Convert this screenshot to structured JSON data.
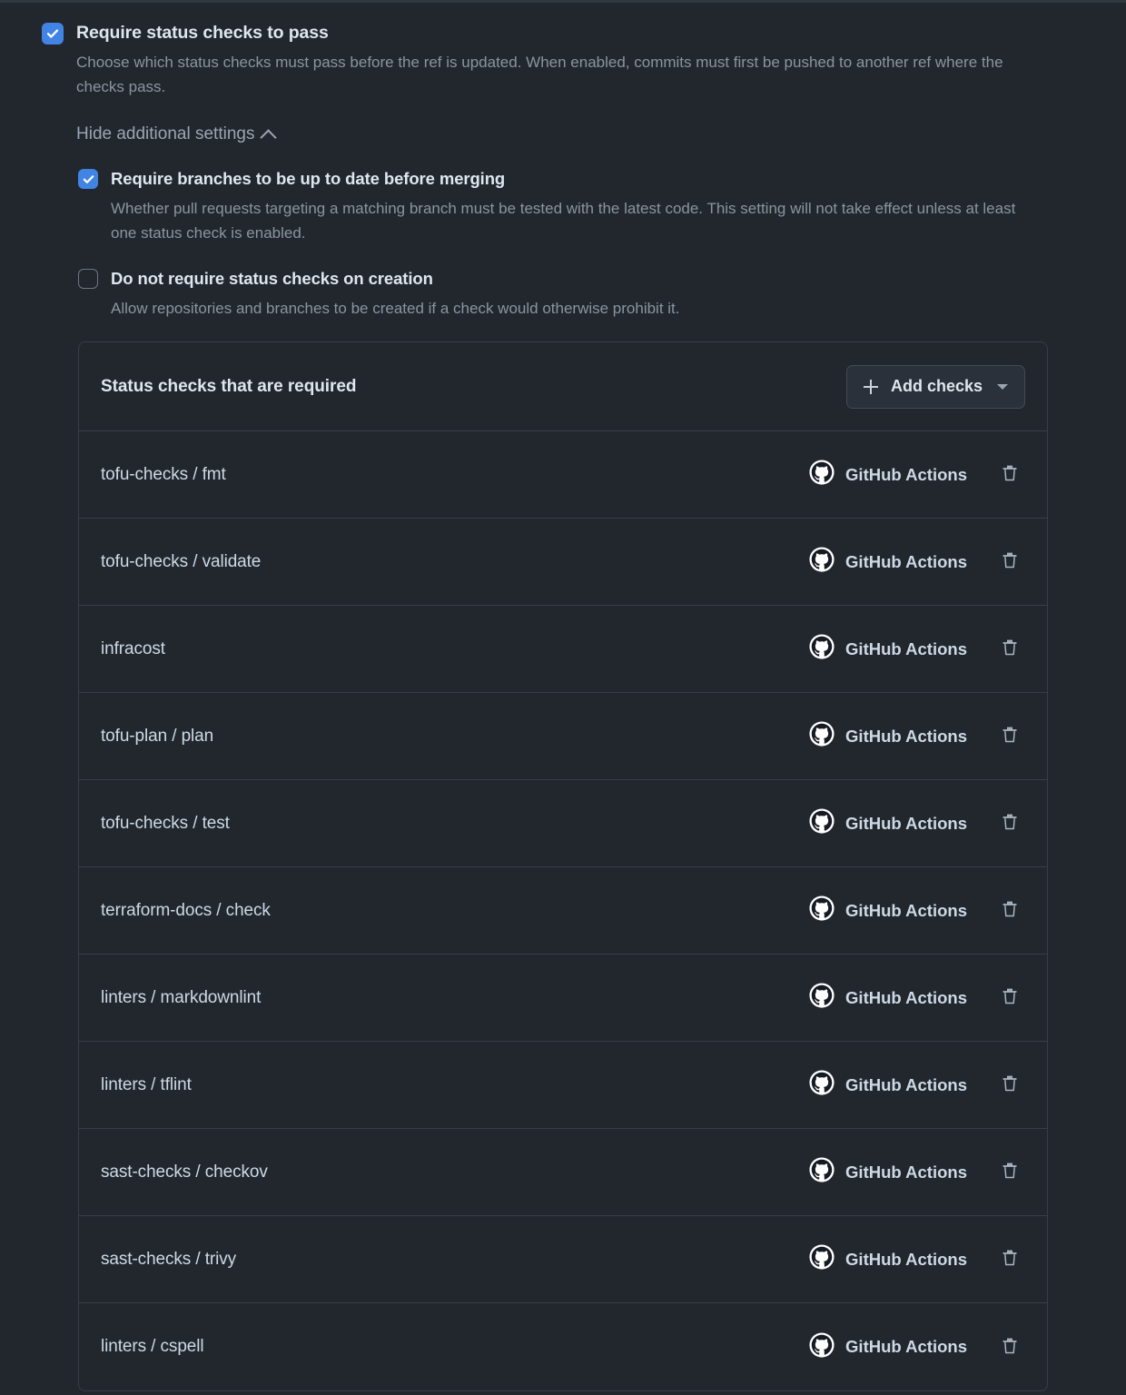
{
  "settings": {
    "require_status_checks": {
      "label": "Require status checks to pass",
      "description": "Choose which status checks must pass before the ref is updated. When enabled, commits must first be pushed to another ref where the checks pass.",
      "checked": true
    },
    "toggle_additional": {
      "label": "Hide additional settings",
      "icon": "chevron-up-icon"
    },
    "require_up_to_date": {
      "label": "Require branches to be up to date before merging",
      "description": "Whether pull requests targeting a matching branch must be tested with the latest code. This setting will not take effect unless at least one status check is enabled.",
      "checked": true
    },
    "no_checks_on_creation": {
      "label": "Do not require status checks on creation",
      "description": "Allow repositories and branches to be created if a check would otherwise prohibit it.",
      "checked": false
    }
  },
  "checks_card": {
    "title": "Status checks that are required",
    "add_button": {
      "label": "Add checks",
      "plus_icon": "plus-icon",
      "chevron_icon": "chevron-down-icon"
    },
    "rows": [
      {
        "name": "tofu-checks / fmt",
        "source": "GitHub Actions",
        "source_icon": "github-icon",
        "delete_icon": "trash-icon"
      },
      {
        "name": "tofu-checks / validate",
        "source": "GitHub Actions",
        "source_icon": "github-icon",
        "delete_icon": "trash-icon"
      },
      {
        "name": "infracost",
        "source": "GitHub Actions",
        "source_icon": "github-icon",
        "delete_icon": "trash-icon"
      },
      {
        "name": "tofu-plan / plan",
        "source": "GitHub Actions",
        "source_icon": "github-icon",
        "delete_icon": "trash-icon"
      },
      {
        "name": "tofu-checks / test",
        "source": "GitHub Actions",
        "source_icon": "github-icon",
        "delete_icon": "trash-icon"
      },
      {
        "name": "terraform-docs / check",
        "source": "GitHub Actions",
        "source_icon": "github-icon",
        "delete_icon": "trash-icon"
      },
      {
        "name": "linters / markdownlint",
        "source": "GitHub Actions",
        "source_icon": "github-icon",
        "delete_icon": "trash-icon"
      },
      {
        "name": "linters / tflint",
        "source": "GitHub Actions",
        "source_icon": "github-icon",
        "delete_icon": "trash-icon"
      },
      {
        "name": "sast-checks / checkov",
        "source": "GitHub Actions",
        "source_icon": "github-icon",
        "delete_icon": "trash-icon"
      },
      {
        "name": "sast-checks / trivy",
        "source": "GitHub Actions",
        "source_icon": "github-icon",
        "delete_icon": "trash-icon"
      },
      {
        "name": "linters / cspell",
        "source": "GitHub Actions",
        "source_icon": "github-icon",
        "delete_icon": "trash-icon"
      }
    ]
  },
  "colors": {
    "page_background": "#22272e",
    "checkbox_accent": "#4184e4",
    "border": "#373e47",
    "text_primary": "#cdd9e5",
    "text_muted": "#8b949e"
  }
}
